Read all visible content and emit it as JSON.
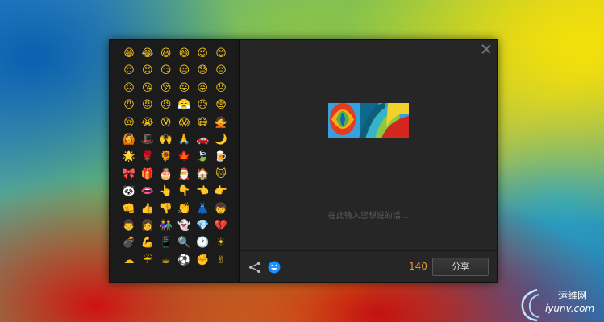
{
  "emoji_panel": {
    "emojis": [
      "😁",
      "😂",
      "😃",
      "😄",
      "😉",
      "😊",
      "😌",
      "😍",
      "😏",
      "😒",
      "😓",
      "😔",
      "😖",
      "😘",
      "😚",
      "😜",
      "😝",
      "😞",
      "😠",
      "😡",
      "😣",
      "😤",
      "😥",
      "😨",
      "😪",
      "😭",
      "😰",
      "😱",
      "😷",
      "🙅",
      "🙆",
      "🎩",
      "🙌",
      "🙏",
      "🚗",
      "🌙",
      "🌟",
      "🌹",
      "🌻",
      "🍁",
      "🍃",
      "🍺",
      "🎀",
      "🎁",
      "🎂",
      "🎅",
      "🏠",
      "🐱",
      "🐼",
      "👄",
      "👆",
      "👇",
      "👈",
      "👉",
      "👊",
      "👍",
      "👎",
      "👏",
      "👗",
      "👦",
      "👨",
      "👩",
      "👫",
      "👻",
      "💎",
      "💔",
      "💣",
      "💪",
      "📱",
      "🔍",
      "🕐",
      "☀",
      "☁",
      "☔",
      "☕",
      "⚽",
      "✊",
      "✌"
    ]
  },
  "composer": {
    "placeholder": "在此输入您想说的话...",
    "char_count": "140",
    "share_label": "分享"
  },
  "icons": {
    "close": "close-icon",
    "share": "share-nodes-icon",
    "emoji": "smile-icon"
  },
  "colors": {
    "count": "#e8962c",
    "emoji_icon": "#1e90ff"
  },
  "watermark": {
    "line1": "运维网",
    "line2": "iyunv.com"
  }
}
